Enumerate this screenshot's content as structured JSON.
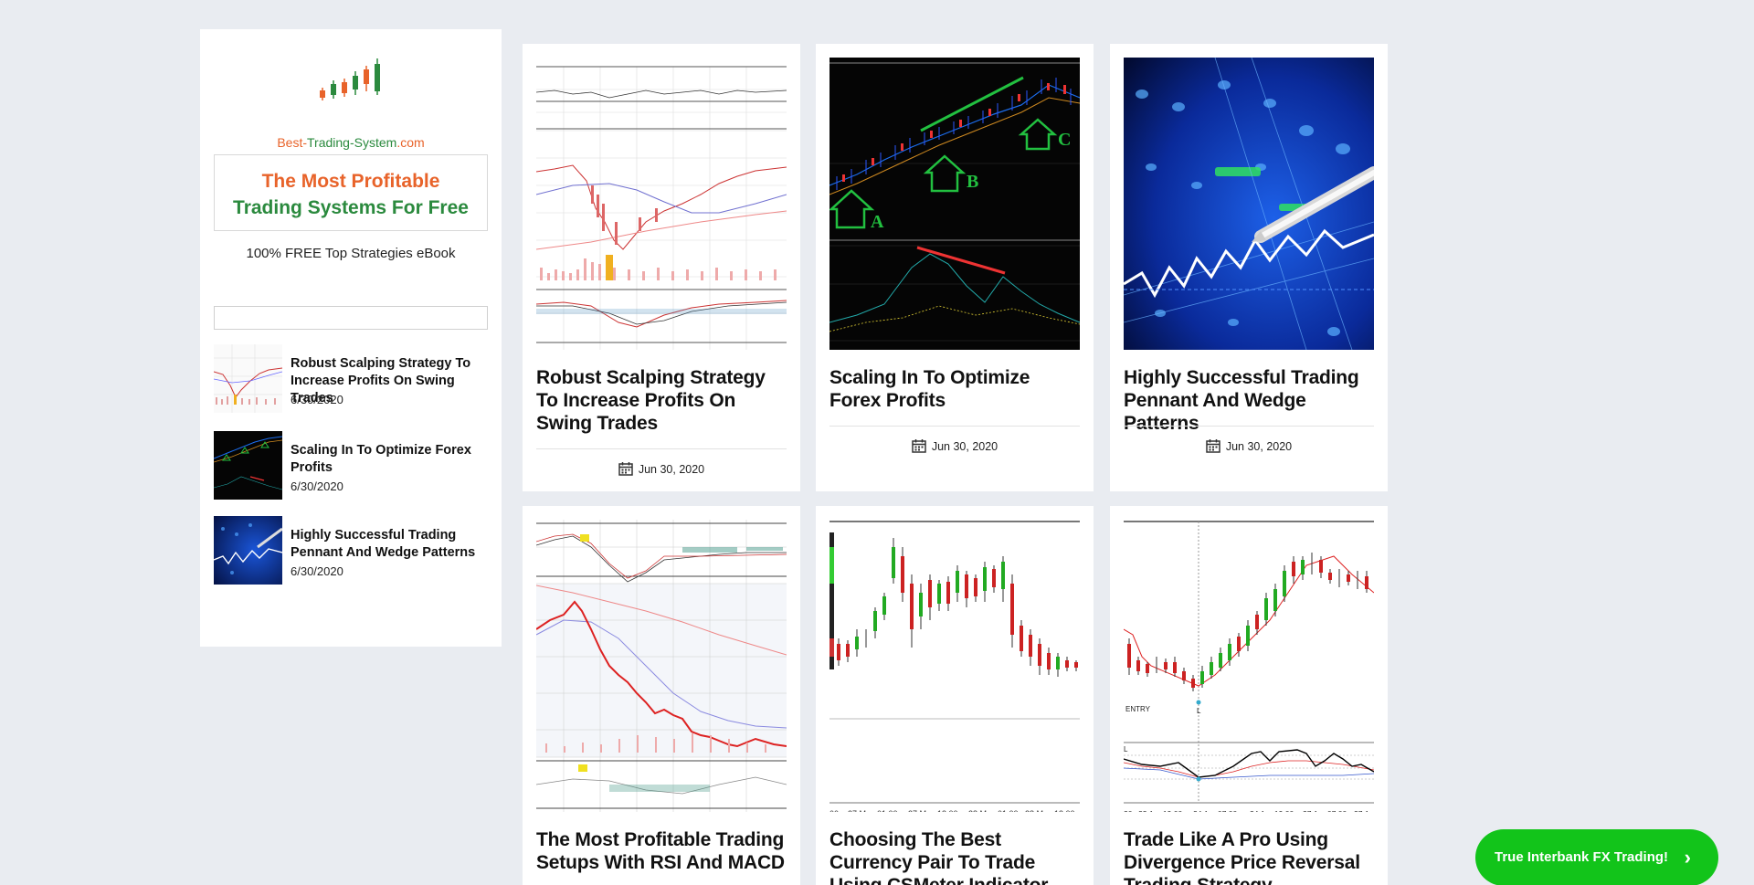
{
  "logo": {
    "text_prefix": "Best-",
    "text_mid": "Trading-System",
    "text_suffix": ".com"
  },
  "promo": {
    "line1": "The Most Profitable",
    "line2": "Trading Systems For Free",
    "subtitle": "100% FREE Top Strategies eBook"
  },
  "search": {
    "placeholder": ""
  },
  "sidebar_posts": [
    {
      "title": "Robust Scalping Strategy To Increase Profits On Swing Trades",
      "date": "6/30/2020",
      "thumb": "candles-light"
    },
    {
      "title": "Scaling In To Optimize Forex Profits",
      "date": "6/30/2020",
      "thumb": "candles-dark"
    },
    {
      "title": "Highly Successful Trading Pennant And Wedge Patterns",
      "date": "6/30/2020",
      "thumb": "blue-screen"
    }
  ],
  "cards": [
    {
      "title": "Robust Scalping Strategy To Increase Profits On Swing Trades",
      "date": "Jun 30, 2020",
      "image": "stock-chart-light"
    },
    {
      "title": "Scaling In To Optimize Forex Profits",
      "date": "Jun 30, 2020",
      "image": "forex-chart-dark-abc"
    },
    {
      "title": "Highly Successful Trading Pennant And Wedge Patterns",
      "date": "Jun 30, 2020",
      "image": "blue-screen-pen"
    },
    {
      "title": "The Most Profitable Trading Setups With RSI And MACD",
      "image": "stock-chart-macd"
    },
    {
      "title": "Choosing The Best Currency Pair To Trade Using CSMeter Indicator",
      "image": "forex-candles-white"
    },
    {
      "title": "Trade Like A Pro Using Divergence Price Reversal Trading Strategy",
      "image": "divergence-chart"
    }
  ],
  "cta": {
    "label": "True Interbank FX Trading!",
    "icon": "chevron-right-icon"
  },
  "colors": {
    "orange": "#e8632a",
    "green": "#2b8a3e",
    "cta": "#12c41a",
    "background": "#e9ecf1"
  }
}
